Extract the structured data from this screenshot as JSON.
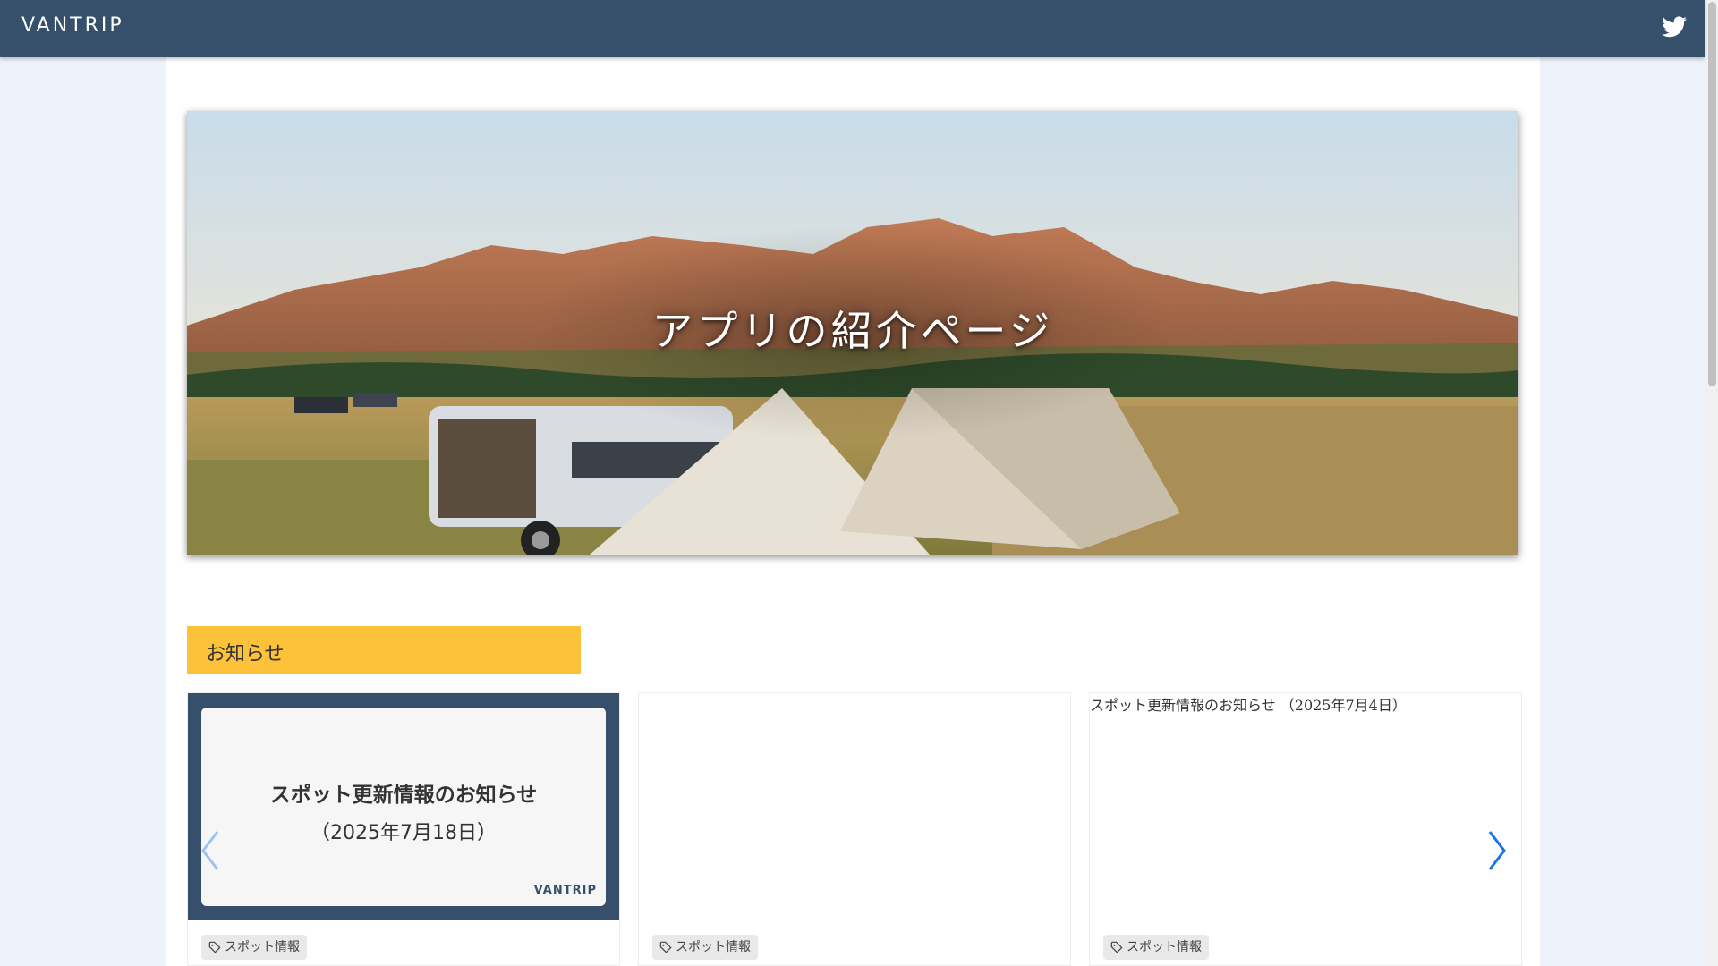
{
  "header": {
    "brand": "VANTRIP",
    "icon": "twitter-icon"
  },
  "hero": {
    "title": "アプリの紹介ページ"
  },
  "notices": {
    "heading": "お知らせ",
    "cards": [
      {
        "thumb_title": "スポット更新情報のお知らせ",
        "thumb_date": "（2025年7月18日）",
        "thumb_brand": "VANTRIP",
        "tag": "スポット情報"
      },
      {
        "tag": "スポット情報"
      },
      {
        "alt_text": "スポット更新情報のお知らせ （2025年7月4日）",
        "tag": "スポット情報"
      }
    ]
  },
  "colors": {
    "header": "#36506b",
    "section_head": "#fdc13a",
    "arrow": "#1a73e8"
  }
}
